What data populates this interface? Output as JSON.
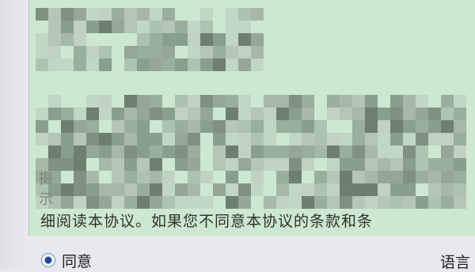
{
  "agreement": {
    "header_obscured": true,
    "body_obscured": true,
    "faint_chars": [
      "摄",
      "示"
    ],
    "visible_line": "细阅读本协议。如果您不同意本协议的条款和条"
  },
  "footer": {
    "agree_radio_label": "同意",
    "agree_selected": true,
    "language_label": "语言"
  }
}
